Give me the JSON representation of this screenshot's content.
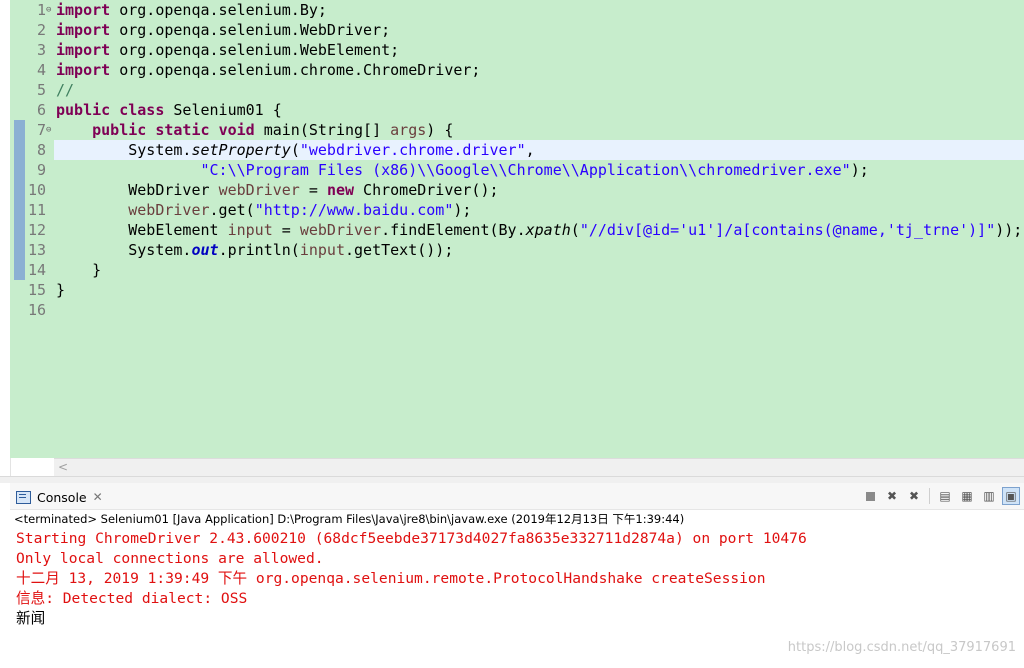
{
  "editor": {
    "lines": [
      {
        "num": "1",
        "fold": "⊖",
        "parts": [
          {
            "t": "import",
            "c": "kw"
          },
          {
            "t": " org.openqa.selenium.By;"
          }
        ]
      },
      {
        "num": "2",
        "parts": [
          {
            "t": "import",
            "c": "kw"
          },
          {
            "t": " org.openqa.selenium.WebDriver;"
          }
        ]
      },
      {
        "num": "3",
        "parts": [
          {
            "t": "import",
            "c": "kw"
          },
          {
            "t": " org.openqa.selenium.WebElement;"
          }
        ]
      },
      {
        "num": "4",
        "parts": [
          {
            "t": "import",
            "c": "kw"
          },
          {
            "t": " org.openqa.selenium.chrome.ChromeDriver;"
          }
        ]
      },
      {
        "num": "5",
        "parts": [
          {
            "t": "//",
            "c": "cm"
          }
        ]
      },
      {
        "num": "6",
        "parts": [
          {
            "t": "public",
            "c": "kw"
          },
          {
            "t": " "
          },
          {
            "t": "class",
            "c": "kw"
          },
          {
            "t": " Selenium01 {"
          }
        ]
      },
      {
        "num": "7",
        "fold": "⊖",
        "parts": [
          {
            "t": "    "
          },
          {
            "t": "public",
            "c": "kw"
          },
          {
            "t": " "
          },
          {
            "t": "static",
            "c": "kw"
          },
          {
            "t": " "
          },
          {
            "t": "void",
            "c": "kw"
          },
          {
            "t": " main(String[] "
          },
          {
            "t": "args",
            "c": "var"
          },
          {
            "t": ") {"
          }
        ]
      },
      {
        "num": "8",
        "current": true,
        "parts": [
          {
            "t": "        System."
          },
          {
            "t": "setProperty",
            "c": "it"
          },
          {
            "t": "("
          },
          {
            "t": "\"webdriver.chrome.driver\"",
            "c": "str"
          },
          {
            "t": ","
          }
        ]
      },
      {
        "num": "9",
        "parts": [
          {
            "t": "                "
          },
          {
            "t": "\"C:\\\\Program Files (x86)\\\\Google\\\\Chrome\\\\Application\\\\chromedriver.exe\"",
            "c": "str"
          },
          {
            "t": ");"
          }
        ]
      },
      {
        "num": "10",
        "parts": [
          {
            "t": "        WebDriver "
          },
          {
            "t": "webDriver",
            "c": "var"
          },
          {
            "t": " = "
          },
          {
            "t": "new",
            "c": "kw"
          },
          {
            "t": " ChromeDriver();"
          }
        ]
      },
      {
        "num": "11",
        "parts": [
          {
            "t": "        "
          },
          {
            "t": "webDriver",
            "c": "var"
          },
          {
            "t": ".get("
          },
          {
            "t": "\"http://www.baidu.com\"",
            "c": "str"
          },
          {
            "t": ");"
          }
        ]
      },
      {
        "num": "12",
        "parts": [
          {
            "t": "        WebElement "
          },
          {
            "t": "input",
            "c": "var"
          },
          {
            "t": " = "
          },
          {
            "t": "webDriver",
            "c": "var"
          },
          {
            "t": ".findElement(By."
          },
          {
            "t": "xpath",
            "c": "it"
          },
          {
            "t": "("
          },
          {
            "t": "\"//div[@id='u1']/a[contains(@name,'tj_trne')]\"",
            "c": "str"
          },
          {
            "t": "));"
          }
        ]
      },
      {
        "num": "13",
        "parts": [
          {
            "t": "        System."
          },
          {
            "t": "out",
            "c": "field"
          },
          {
            "t": ".println("
          },
          {
            "t": "input",
            "c": "var"
          },
          {
            "t": ".getText());"
          }
        ]
      },
      {
        "num": "14",
        "parts": [
          {
            "t": "    }"
          }
        ]
      },
      {
        "num": "15",
        "parts": [
          {
            "t": "}"
          }
        ]
      },
      {
        "num": "16",
        "parts": []
      }
    ],
    "scroll_left_arrow": "<"
  },
  "console": {
    "tab_label": "Console",
    "tab_close": "✕",
    "status": "<terminated> Selenium01 [Java Application] D:\\Program Files\\Java\\jre8\\bin\\javaw.exe (2019年12月13日 下午1:39:44)",
    "output": [
      {
        "text": "Starting ChromeDriver 2.43.600210 (68dcf5eebde37173d4027fa8635e332711d2874a) on port 10476",
        "kind": "err"
      },
      {
        "text": "Only local connections are allowed.",
        "kind": "err"
      },
      {
        "text": "十二月 13, 2019 1:39:49 下午 org.openqa.selenium.remote.ProtocolHandshake createSession",
        "kind": "err"
      },
      {
        "text": "信息: Detected dialect: OSS",
        "kind": "err"
      },
      {
        "text": "新闻",
        "kind": "norm"
      }
    ],
    "toolbar": [
      {
        "name": "terminate-icon",
        "glyph": ""
      },
      {
        "name": "remove-launch-icon",
        "glyph": "✖"
      },
      {
        "name": "remove-all-terminated-icon",
        "glyph": "✖"
      },
      {
        "name": "scroll-lock-icon",
        "glyph": "▤"
      },
      {
        "name": "pin-console-icon",
        "glyph": "▦"
      },
      {
        "name": "word-wrap-icon",
        "glyph": "▥"
      },
      {
        "name": "display-selected-console-icon",
        "glyph": "▣"
      }
    ]
  },
  "watermark": "https://blog.csdn.net/qq_37917691"
}
